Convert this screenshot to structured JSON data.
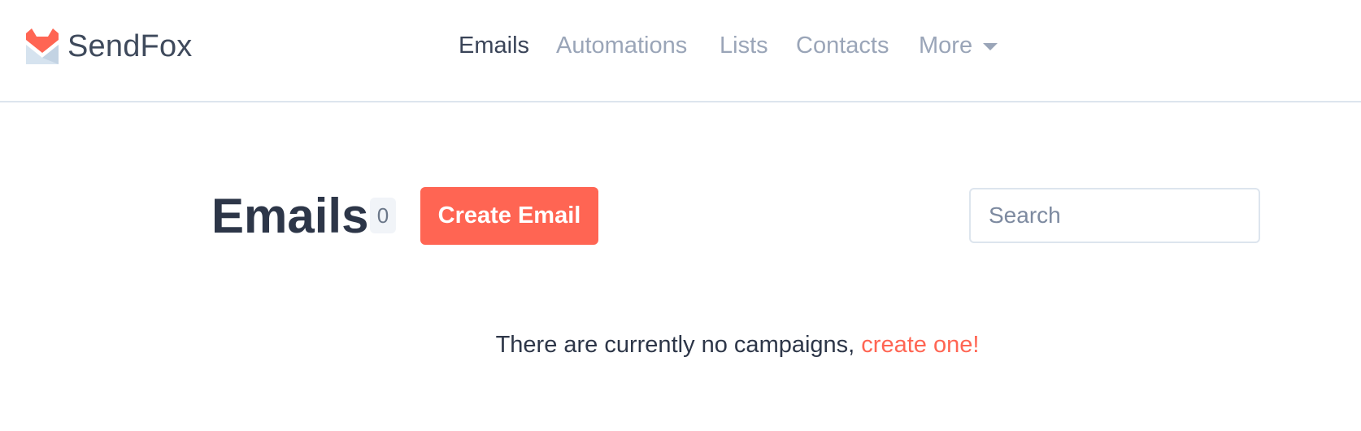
{
  "header": {
    "brand": "SendFox",
    "nav": [
      "Emails",
      "Automations",
      "Lists",
      "Contacts",
      "More"
    ],
    "active_nav": "Emails"
  },
  "main": {
    "title": "Emails",
    "count": "0",
    "create_label": "Create Email",
    "search_placeholder": "Search",
    "empty_text": "There are currently no campaigns, ",
    "empty_link": "create one!"
  },
  "colors": {
    "accent": "#ff6553",
    "nav_active": "#3a4458",
    "nav_inactive": "#9aa5b8"
  },
  "icons": {
    "logo": "fox-envelope-logo",
    "more": "caret-down-icon"
  }
}
